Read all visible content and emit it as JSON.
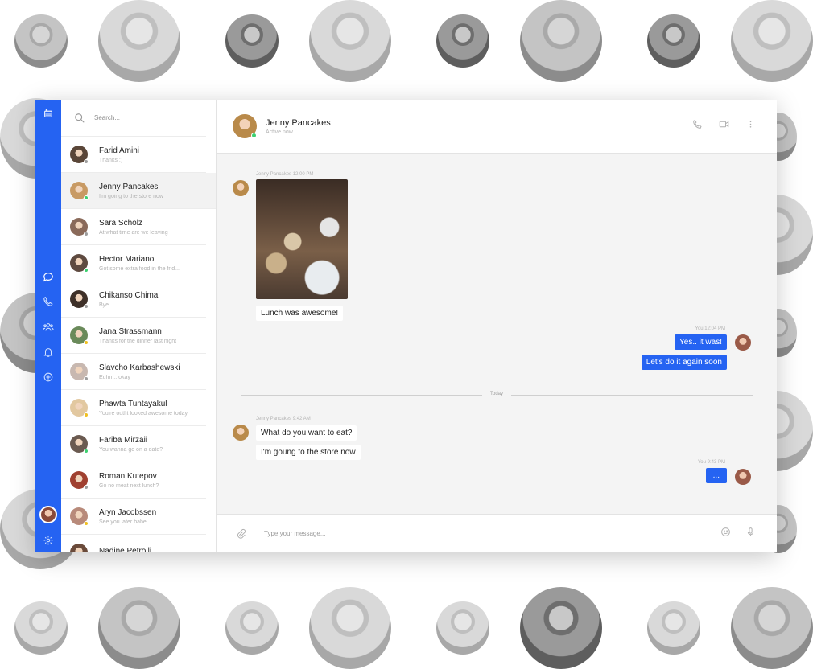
{
  "search": {
    "placeholder": "Search..."
  },
  "contacts": [
    {
      "name": "Farid Amini",
      "preview": "Thanks :)",
      "status_color": "#9e9e9e",
      "avatar": "#5a4638"
    },
    {
      "name": "Jenny Pancakes",
      "preview": "I'm going to the store now",
      "status_color": "#3cd070",
      "avatar": "#c89a64",
      "active": true
    },
    {
      "name": "Sara Scholz",
      "preview": "At what time are we leaving",
      "status_color": "#9e9e9e",
      "avatar": "#8a6a5a"
    },
    {
      "name": "Hector Mariano",
      "preview": "Got some extra food in the frid...",
      "status_color": "#3cd070",
      "avatar": "#5e4a40"
    },
    {
      "name": "Chikanso Chima",
      "preview": "Bye.",
      "status_color": "#9e9e9e",
      "avatar": "#3e3028"
    },
    {
      "name": "Jana Strassmann",
      "preview": "Thanks for the dinner last night",
      "status_color": "#f0c020",
      "avatar": "#6a8a5a"
    },
    {
      "name": "Slavcho Karbashewski",
      "preview": "Euhm.. okay",
      "status_color": "#9e9e9e",
      "avatar": "#c8b8b0"
    },
    {
      "name": "Phawta Tuntayakul",
      "preview": "You're outfit looked awesome today",
      "status_color": "#f0c020",
      "avatar": "#e2c8a0"
    },
    {
      "name": "Fariba Mirzaii",
      "preview": "You wanna go on a date?",
      "status_color": "#3cd070",
      "avatar": "#6a5a50"
    },
    {
      "name": "Roman Kutepov",
      "preview": "Go no meat next lunch?",
      "status_color": "#9e9e9e",
      "avatar": "#a04030"
    },
    {
      "name": "Aryn Jacobssen",
      "preview": "See you later babe",
      "status_color": "#f0c020",
      "avatar": "#b88a7a"
    },
    {
      "name": "Nadine Petrolli",
      "preview": "",
      "status_color": "#9e9e9e",
      "avatar": "#6a4a3a"
    }
  ],
  "chat": {
    "contact_name": "Jenny Pancakes",
    "contact_status": "Active now",
    "messages": {
      "meta_1": "Jenny Pancakes 12:00 PM",
      "msg_1": "Lunch was awesome!",
      "meta_2": "You 12:04 PM",
      "msg_2": "Yes.. it was!",
      "msg_3": "Let's do it again soon",
      "divider": "Today",
      "meta_3": "Jenny Pancakes 9:42 AM",
      "msg_4": "What do you want to eat?",
      "msg_5": "I'm goung to the store now",
      "meta_4": "You 9:43 PM",
      "msg_6": "..."
    },
    "composer_placeholder": "Type your message..."
  },
  "colors": {
    "accent": "#2563f2"
  }
}
